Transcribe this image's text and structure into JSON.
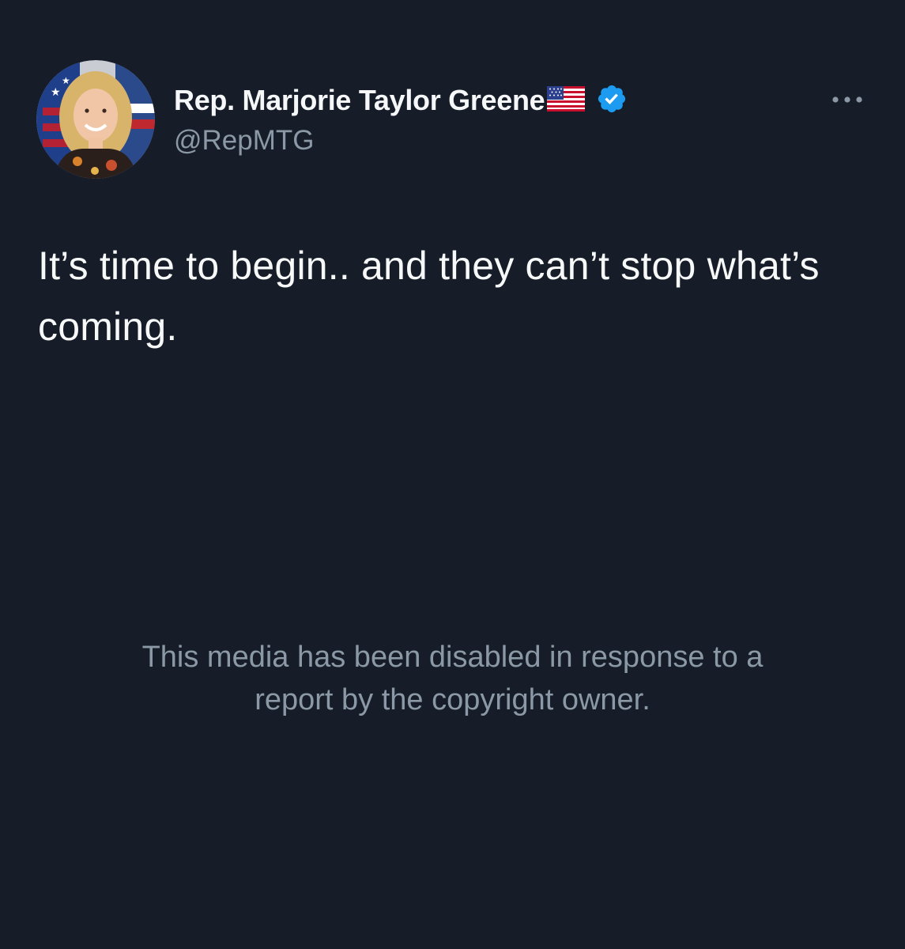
{
  "tweet": {
    "author": {
      "display_name": "Rep. Marjorie Taylor Greene",
      "flag_emoji": "🇺🇸",
      "handle": "@RepMTG",
      "verified": true,
      "verified_color": "#1d9bf0"
    },
    "text": "It’s time to begin.. and they can’t stop what’s coming.",
    "media_notice": {
      "line1": "This media has been disabled in response to a",
      "line2": "report by the copyright owner."
    },
    "more_icon": "more-horizontal-icon"
  },
  "theme": {
    "background": "#161d29",
    "text_primary": "#f7f9f9",
    "text_secondary": "#8b98a5"
  }
}
